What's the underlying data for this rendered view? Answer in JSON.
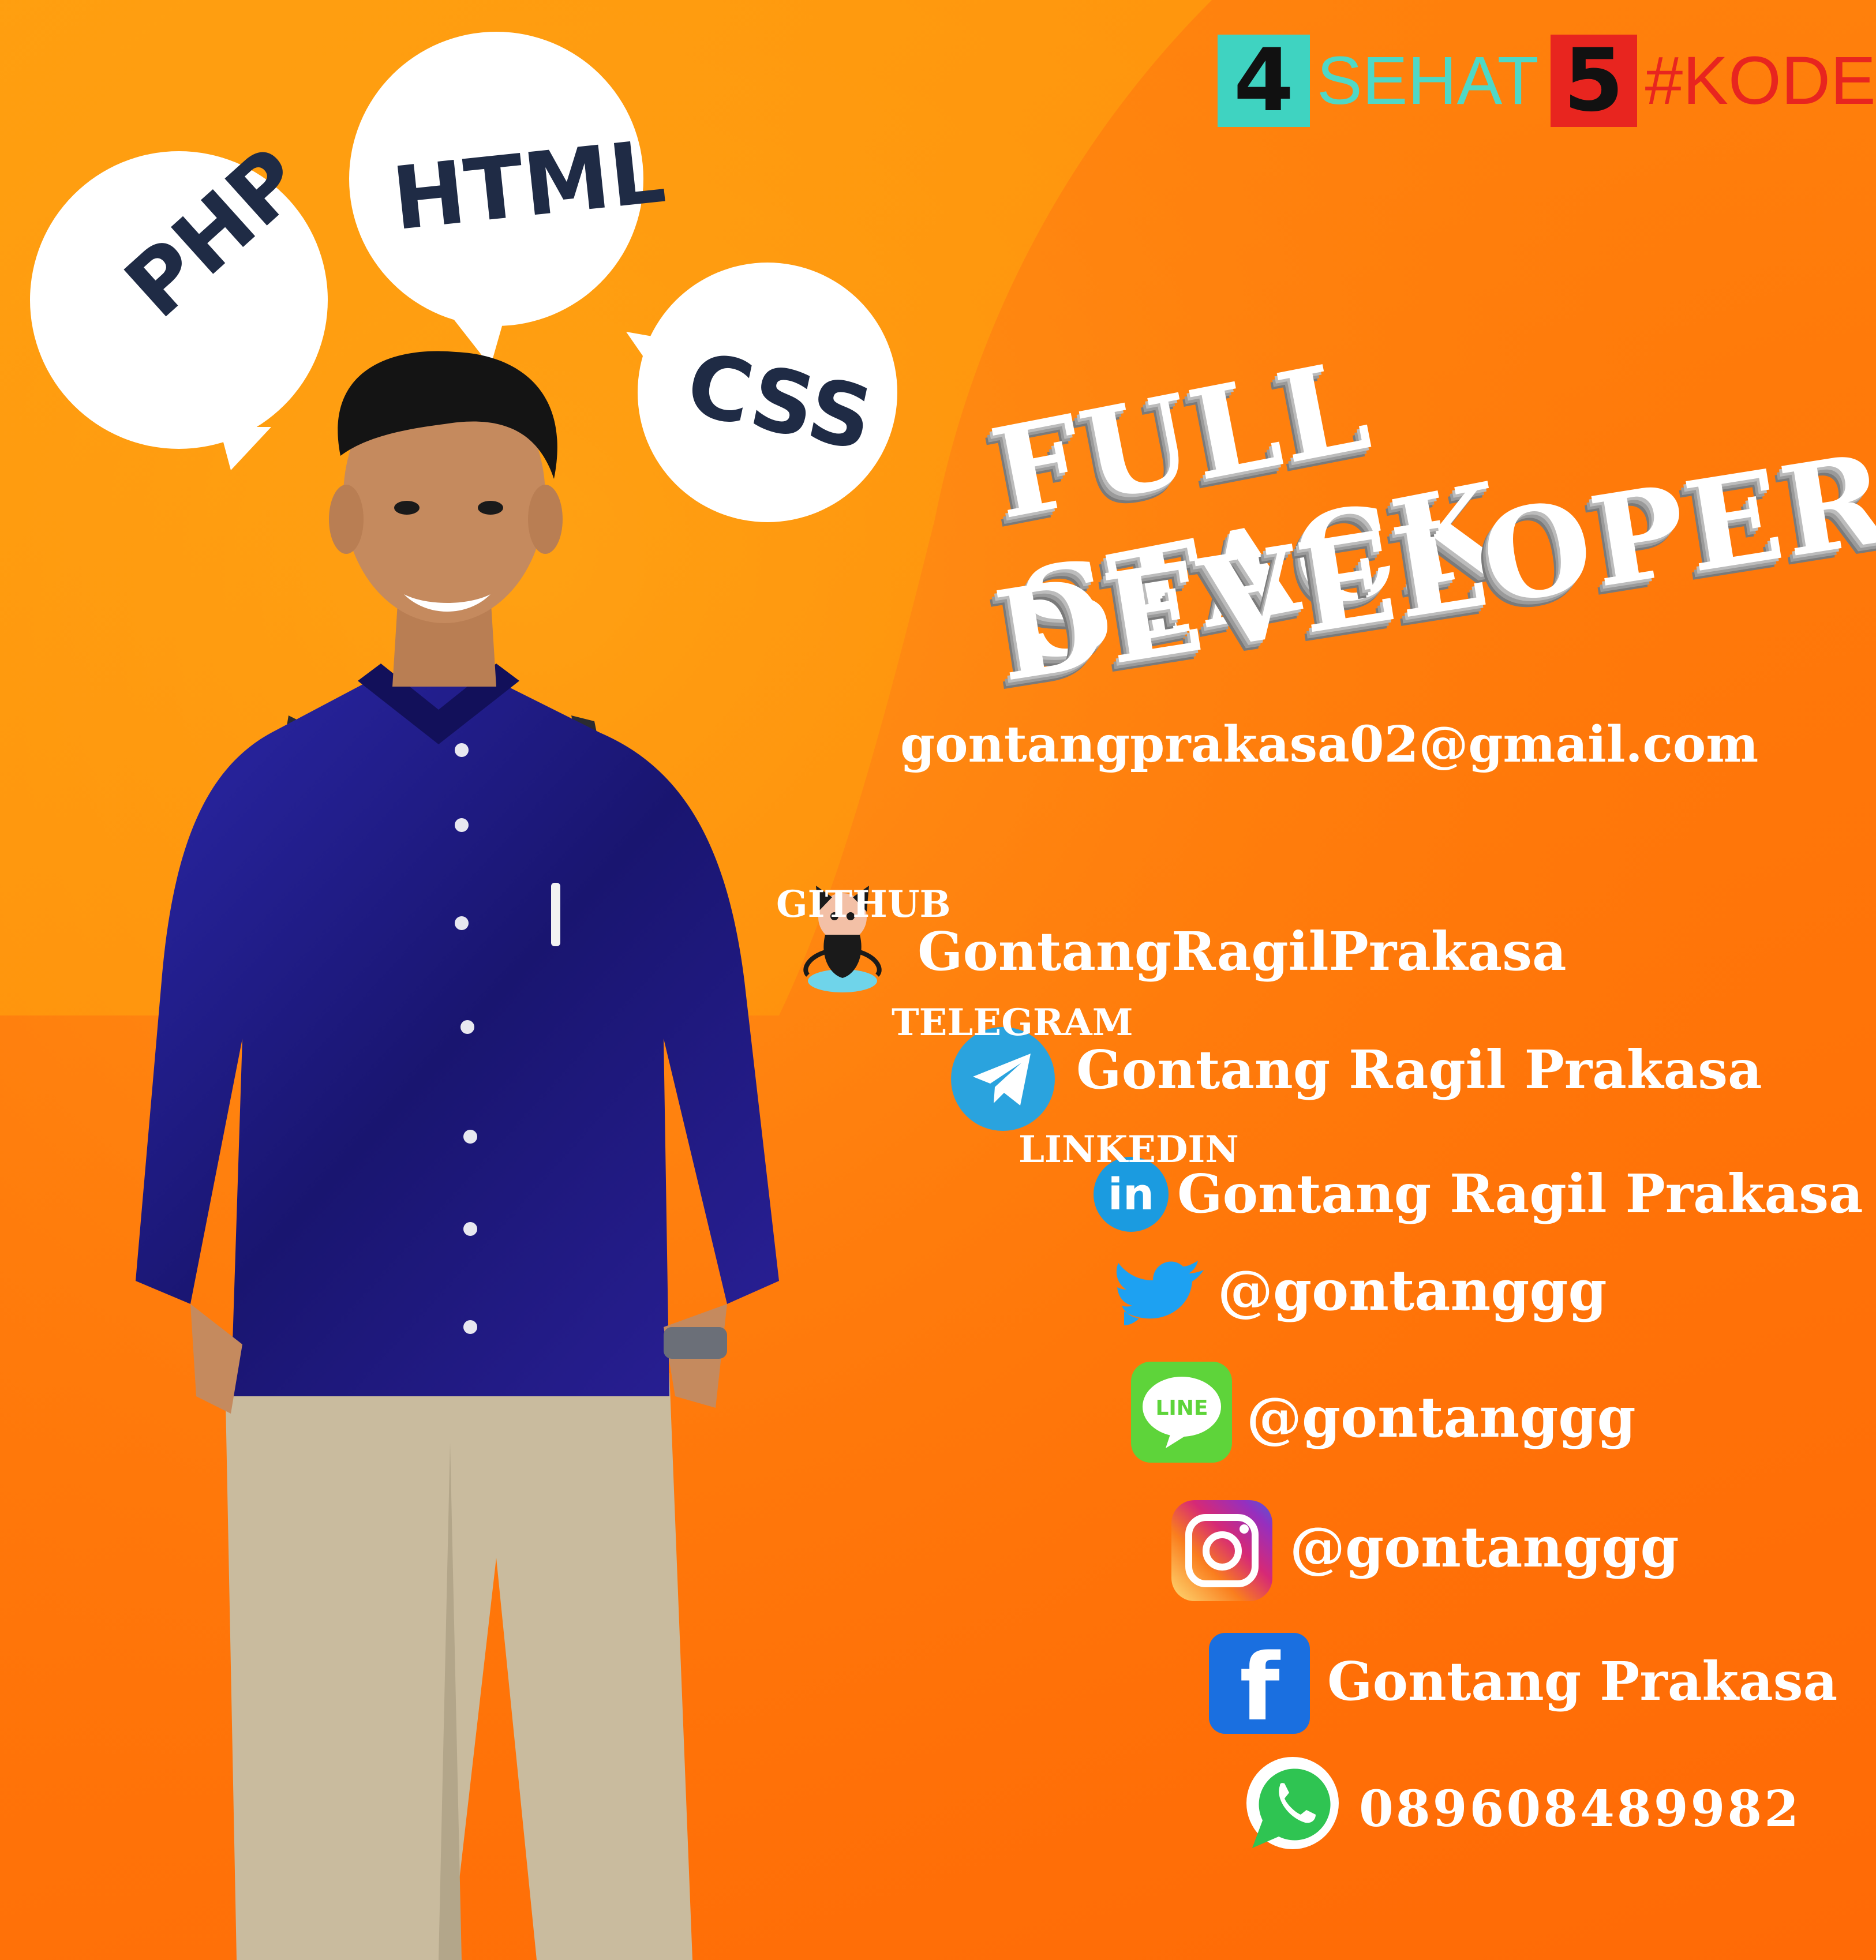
{
  "logo": {
    "num1": "4",
    "word1": "SEHAT",
    "num2": "5",
    "word2": "#KODE"
  },
  "bubbles": {
    "php": "PHP",
    "html": "HTML",
    "css": "CSS"
  },
  "headline": {
    "line1": "FULL STACK",
    "line2": "DEVELOPER"
  },
  "contacts": {
    "email": "gontangprakasa02@gmail.com",
    "github": {
      "label": "GITHUB",
      "value": "GontangRagilPrakasa"
    },
    "telegram": {
      "label": "TELEGRAM",
      "value": "Gontang Ragil Prakasa"
    },
    "linkedin": {
      "label": "LINKEDIN",
      "value": "Gontang Ragil Prakasa"
    },
    "twitter": "@gontanggg",
    "line": "@gontanggg",
    "instagram": "@gontanggg",
    "facebook": "Gontang Prakasa",
    "whatsapp": "089608489982"
  },
  "icon_text": {
    "line": "LINE",
    "linkedin": "in",
    "facebook": "f"
  },
  "colors": {
    "background": "#ff7a0a",
    "accent_curve": "#ffa50a",
    "bubble": "#ffffff",
    "bubble_text": "#1f2b45",
    "logo_teal": "#3fd3c1",
    "logo_red": "#e8251f",
    "telegram": "#2aa3de",
    "linkedin": "#1b9be0",
    "twitter": "#1da1f2",
    "line": "#5ed43a",
    "facebook": "#1a6fe0",
    "whatsapp": "#2fc452",
    "shirt": "#1d1a7a",
    "pants": "#c9bb9e"
  },
  "icons": [
    "github-octocat-icon",
    "telegram-icon",
    "linkedin-icon",
    "twitter-icon",
    "line-icon",
    "instagram-icon",
    "facebook-icon",
    "whatsapp-icon"
  ]
}
